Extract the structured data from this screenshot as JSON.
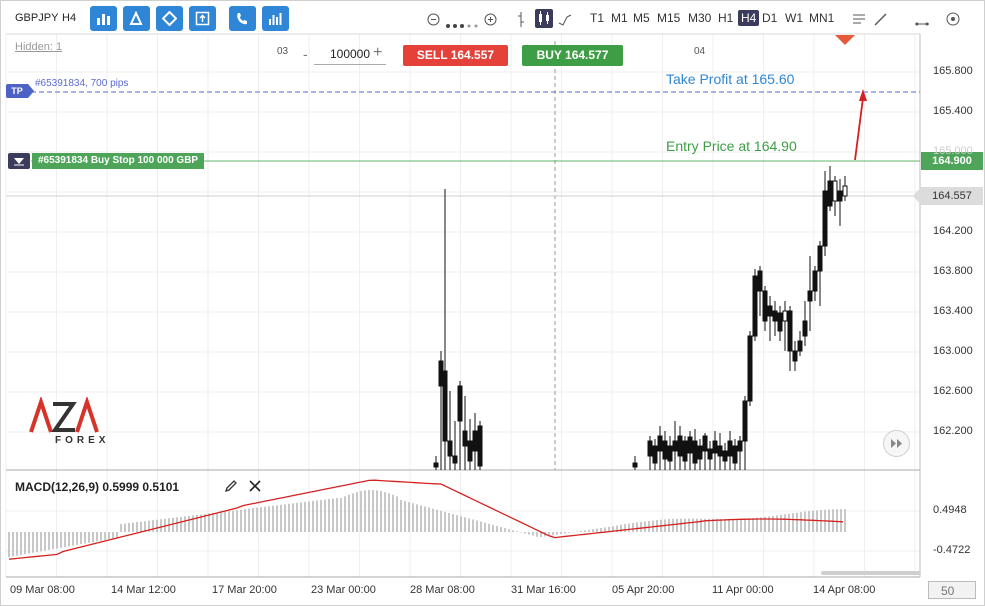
{
  "toolbar": {
    "symbol": "GBPJPY",
    "timeframe": "H4",
    "timeframes": [
      "T1",
      "M1",
      "M5",
      "M15",
      "M30",
      "H1",
      "H4",
      "D1",
      "W1",
      "MN1"
    ],
    "active_timeframe": "H4"
  },
  "chart_header": {
    "hidden_label": "Hidden: 1",
    "session_left": "03",
    "session_right": "04",
    "quantity": "100000",
    "minus": "-",
    "plus": "+",
    "sell_label": "SELL 164.557",
    "buy_label": "BUY 164.577"
  },
  "orders": {
    "tp_tag": "TP",
    "tp_text": "#65391834, 700 pips",
    "order_text": "#65391834 Buy Stop 100 000 GBP",
    "order_price": "164.900",
    "current_price": "164.557"
  },
  "annotations": {
    "take_profit": "Take Profit at 165.60",
    "entry": "Entry Price at 164.90"
  },
  "price_axis": [
    "165.800",
    "165.400",
    "165.000",
    "164.200",
    "163.800",
    "163.400",
    "163.000",
    "162.600",
    "162.200"
  ],
  "macd": {
    "label": "MACD(12,26,9) 0.5999 0.5101",
    "axis": [
      "0.4948",
      "-0.4722"
    ]
  },
  "date_axis": [
    "09 Mar 08:00",
    "14 Mar 12:00",
    "17 Mar 20:00",
    "23 Mar 00:00",
    "28 Mar 08:00",
    "31 Mar 16:00",
    "05 Apr 20:00",
    "11 Apr 00:00",
    "14 Apr 08:00"
  ],
  "zoom": "50",
  "logo": {
    "main": "AZA",
    "sub": "FOREX"
  },
  "colors": {
    "accent": "#2f86d6",
    "sell": "#e4413a",
    "buy": "#3d9e45",
    "tp": "#5b6bd1",
    "signal": "#d62020"
  }
}
